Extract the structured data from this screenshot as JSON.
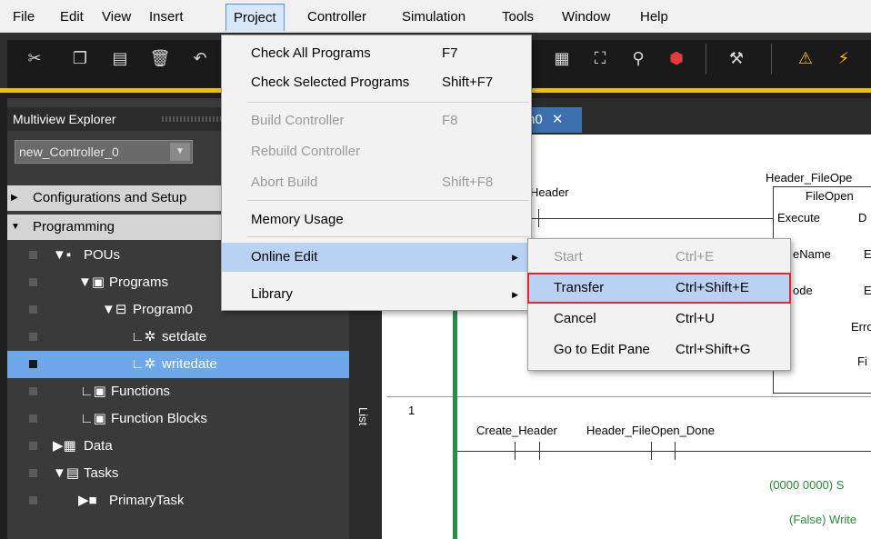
{
  "menubar": {
    "items": [
      "File",
      "Edit",
      "View",
      "Insert",
      "Project",
      "Controller",
      "Simulation",
      "Tools",
      "Window",
      "Help"
    ],
    "active": "Project"
  },
  "toolbar": {
    "icons": [
      "cut-icon",
      "copy-icon",
      "paste-icon",
      "delete-icon",
      "undo-icon",
      "grid-icon",
      "network-icon",
      "binoculars-icon",
      "error-icon",
      "build-icon",
      "warning-icon"
    ]
  },
  "explorer": {
    "title": "Multiview Explorer",
    "controller": "new_Controller_0",
    "sections": {
      "config": "Configurations and Setup",
      "programming": "Programming"
    },
    "tree": {
      "pous": "POUs",
      "programs": "Programs",
      "program0": "Program0",
      "setdate": "setdate",
      "writedate": "writedate",
      "functions": "Functions",
      "function_blocks": "Function Blocks",
      "data": "Data",
      "tasks": "Tasks",
      "primary_task": "PrimaryTask"
    }
  },
  "side_tab": {
    "label": "List"
  },
  "editor": {
    "tab_label": "n0",
    "rung0": {
      "contact_label": "Header",
      "fb_instance": "Header_FileOpe",
      "fb_type": "FileOpen",
      "pins": [
        "Execute",
        "eName",
        "ode",
        "Erro",
        "Fi",
        "D",
        "E",
        "E"
      ]
    },
    "rung1": {
      "number": "1",
      "contact1": "Create_Header",
      "contact2": "Header_FileOpen_Done",
      "value1": "(0000 0000) S",
      "value2": "(False) Write"
    }
  },
  "project_menu": {
    "items": [
      {
        "label": "Check All Programs",
        "shortcut": "F7"
      },
      {
        "label": "Check Selected Programs",
        "shortcut": "Shift+F7"
      },
      {
        "label": "Build Controller",
        "shortcut": "F8"
      },
      {
        "label": "Rebuild Controller",
        "shortcut": ""
      },
      {
        "label": "Abort Build",
        "shortcut": "Shift+F8"
      },
      {
        "label": "Memory Usage",
        "shortcut": ""
      },
      {
        "label": "Online Edit",
        "shortcut": ""
      },
      {
        "label": "Library",
        "shortcut": ""
      }
    ]
  },
  "online_edit_menu": {
    "items": [
      {
        "label": "Start",
        "shortcut": "Ctrl+E"
      },
      {
        "label": "Transfer",
        "shortcut": "Ctrl+Shift+E"
      },
      {
        "label": "Cancel",
        "shortcut": "Ctrl+U"
      },
      {
        "label": "Go to Edit Pane",
        "shortcut": "Ctrl+Shift+G"
      }
    ]
  }
}
